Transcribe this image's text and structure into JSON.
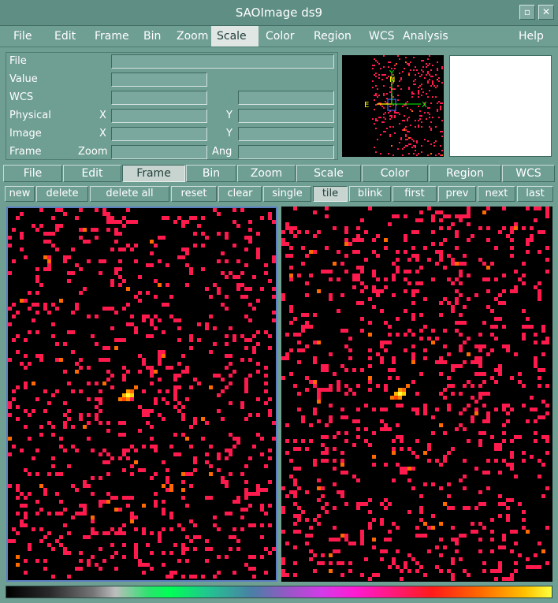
{
  "window": {
    "title": "SAOImage ds9",
    "controls": [
      "▫",
      "✕"
    ]
  },
  "menubar": [
    "File",
    "Edit",
    "Frame",
    "Bin",
    "Zoom",
    "Scale",
    "Color",
    "Region",
    "WCS",
    "Analysis",
    "Help"
  ],
  "menubar_active": "Scale",
  "info": {
    "labels": {
      "file": "File",
      "value": "Value",
      "wcs": "WCS",
      "physical": "Physical",
      "image": "Image",
      "frame": "Frame",
      "x": "X",
      "y": "Y",
      "zoom": "Zoom",
      "ang": "Ang"
    }
  },
  "compass": {
    "north": "N",
    "east": "E",
    "x": "X",
    "y": "Y"
  },
  "buttonbar": [
    "File",
    "Edit",
    "Frame",
    "Bin",
    "Zoom",
    "Scale",
    "Color",
    "Region",
    "WCS"
  ],
  "buttonbar_active": "Frame",
  "framebar": [
    "new",
    "delete",
    "delete all",
    "reset",
    "clear",
    "single",
    "tile",
    "blink",
    "first",
    "prev",
    "next",
    "last"
  ],
  "framebar_active": "tile",
  "colors": {
    "background": "#6f9e93",
    "pixel_red": "#ff1a4d",
    "source_yellow": "#ffe000",
    "frame_selected": "#5c7ec2"
  }
}
